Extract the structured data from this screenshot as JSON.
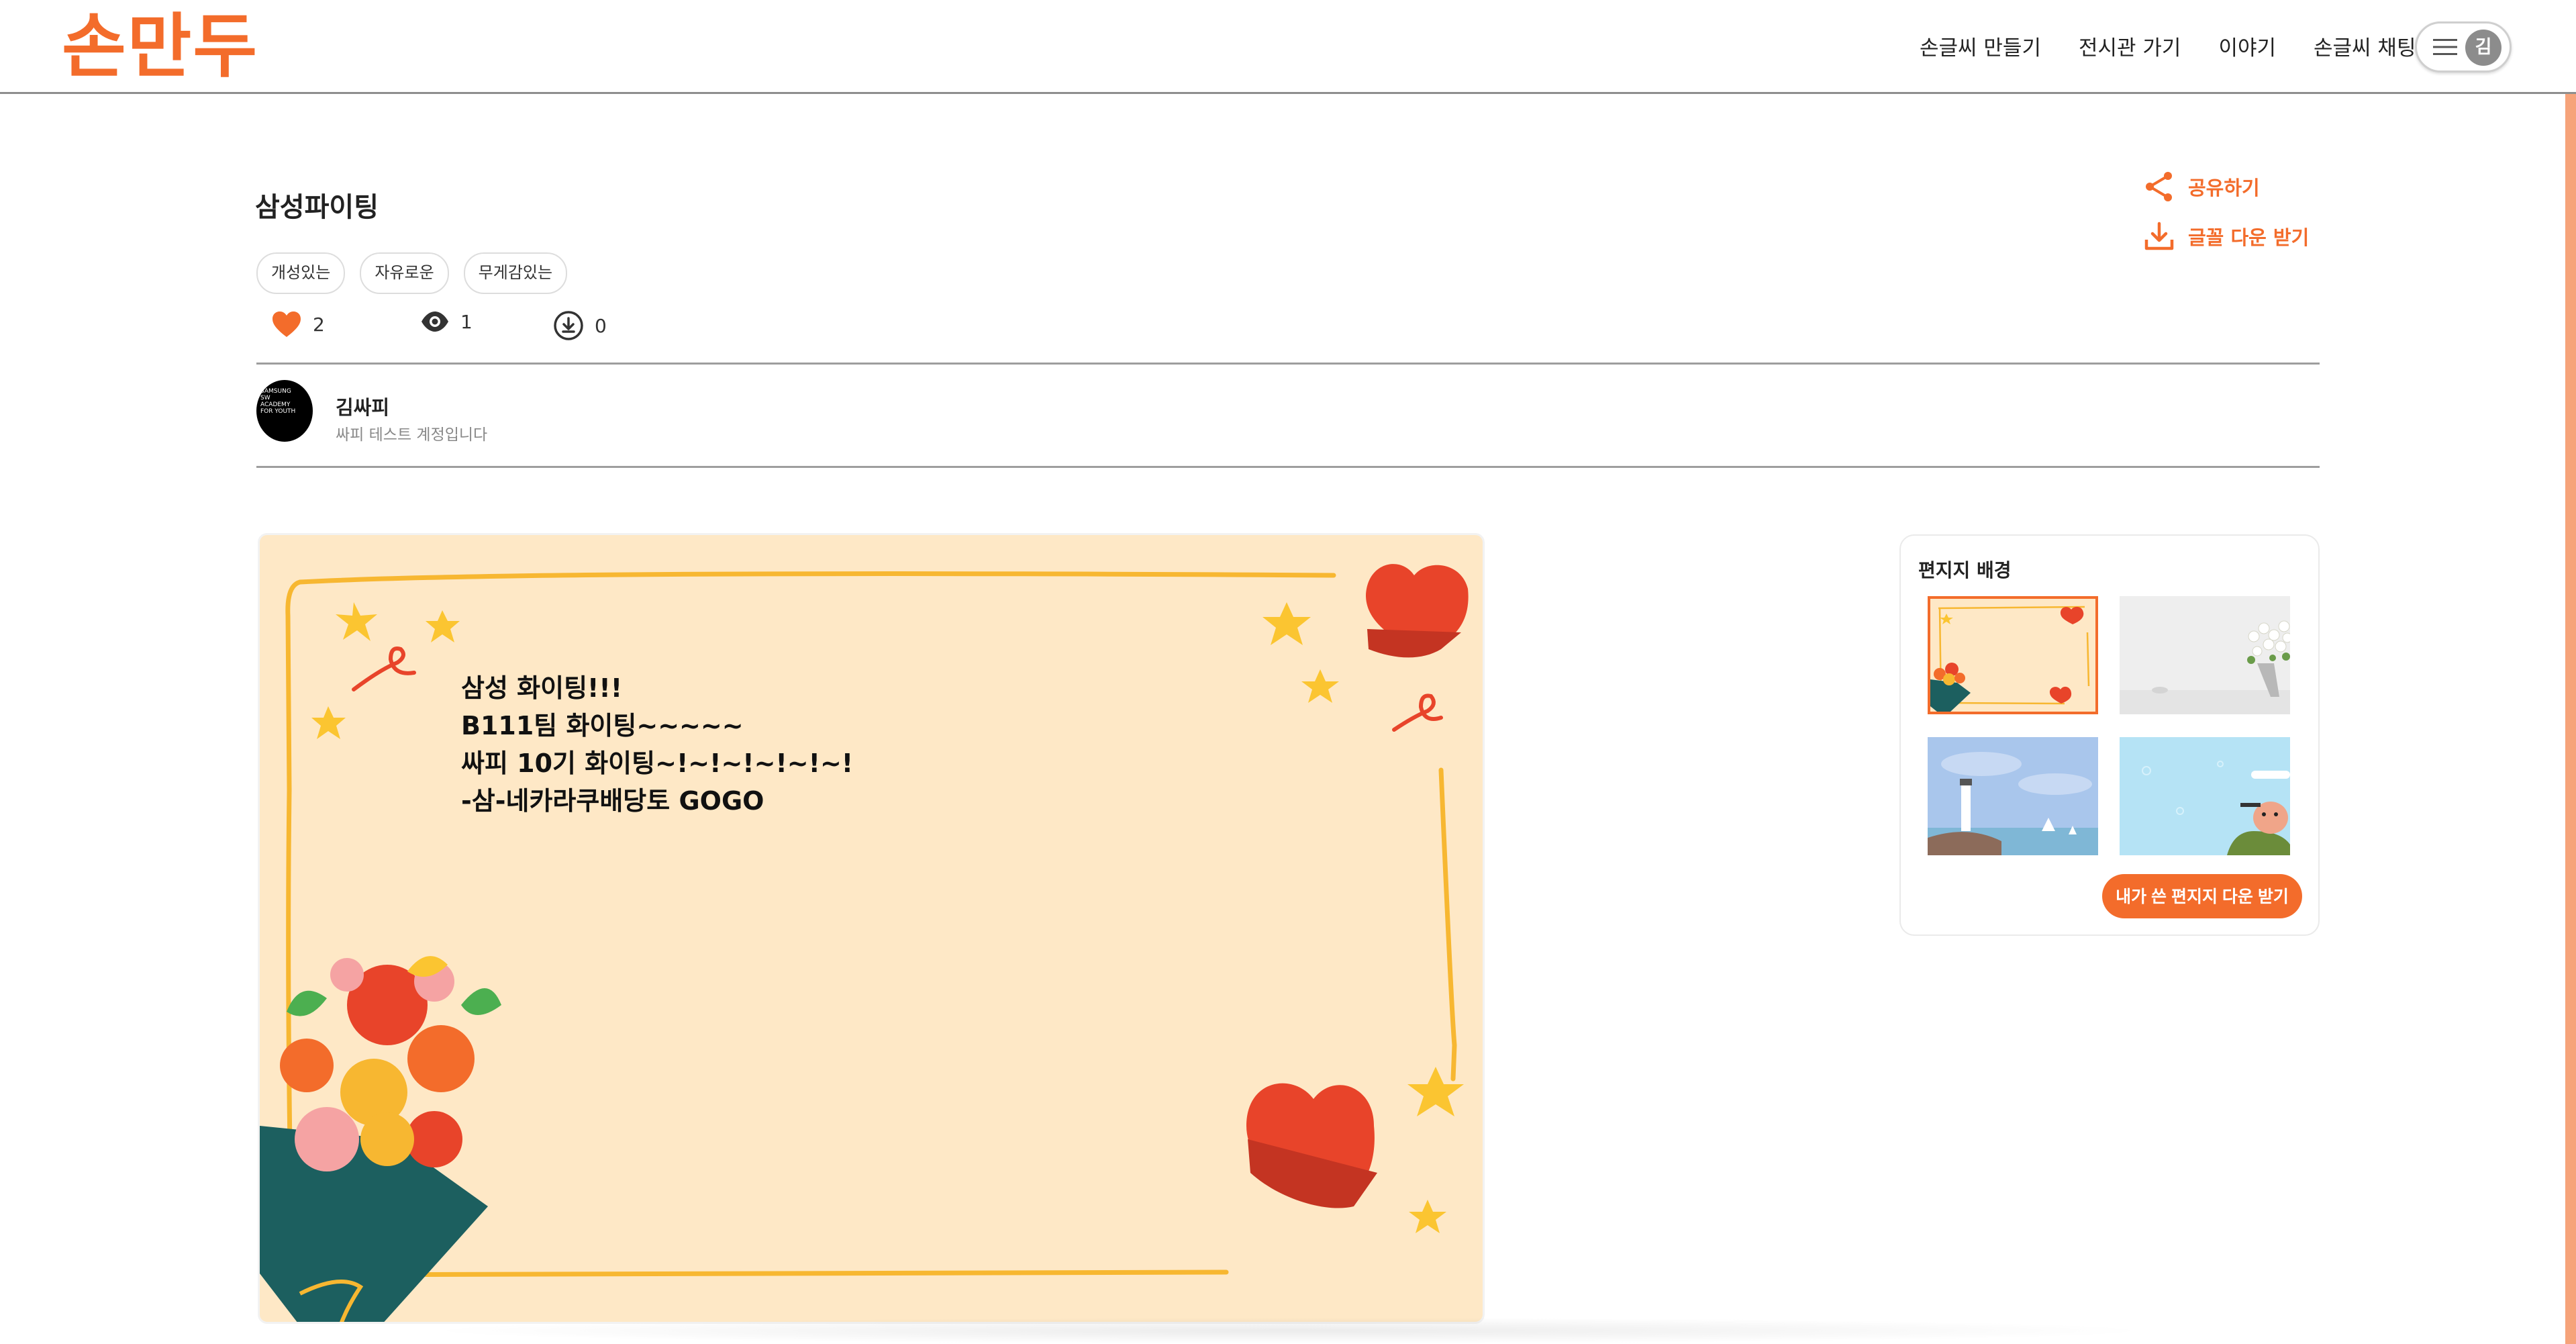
{
  "header": {
    "logo": "손만두",
    "nav": [
      "손글씨 만들기",
      "전시관 가기",
      "이야기",
      "손글씨 채팅"
    ],
    "user_initial": "김"
  },
  "post": {
    "title": "삼성파이팅",
    "tags": [
      "개성있는",
      "자유로운",
      "무게감있는"
    ],
    "likes": "2",
    "views": "1",
    "downloads": "0",
    "share_label": "공유하기",
    "font_download_label": "글꼴 다운 받기"
  },
  "author": {
    "name": "김싸피",
    "description": "싸피 테스트 계정입니다",
    "avatar_text": "SAMSUNG SW ACADEMY FOR YOUTH"
  },
  "letter": {
    "lines": [
      "삼성 화이팅!!!",
      "B111팀 화이팅~~~~~",
      "싸피 10기 화이팅~!~!~!~!~!~!",
      "",
      "-삼-네카라쿠배당토 GOGO"
    ]
  },
  "backgrounds": {
    "title": "편지지 배경",
    "download_button": "내가 쓴 편지지 다운 받기"
  },
  "colors": {
    "accent": "#f36c2b",
    "letter_bg": "#fee8c6"
  }
}
